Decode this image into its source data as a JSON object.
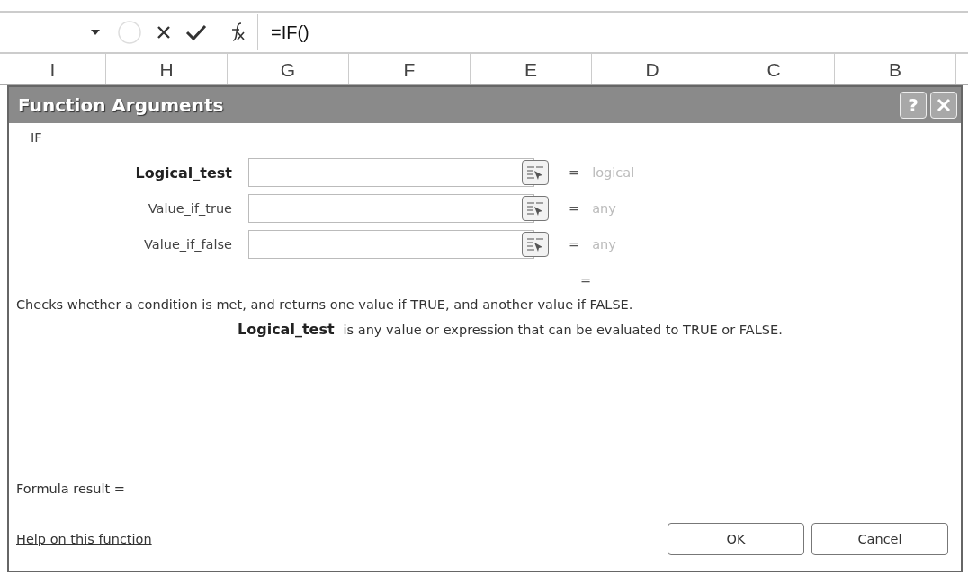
{
  "formula_bar": {
    "formula": "=IF()"
  },
  "column_headers": [
    "I",
    "H",
    "G",
    "F",
    "E",
    "D",
    "C",
    "B"
  ],
  "dialog": {
    "title": "Function Arguments",
    "help_button": "?",
    "function_name": "IF",
    "arguments": [
      {
        "name": "Logical_test",
        "selected": true,
        "equals": "=",
        "result": "logical"
      },
      {
        "name": "Value_if_true",
        "selected": false,
        "equals": "=",
        "result": "any"
      },
      {
        "name": "Value_if_false",
        "selected": false,
        "equals": "=",
        "result": "any"
      }
    ],
    "total_equals": "=",
    "description": "Checks whether a condition is met, and returns one value if TRUE, and another value if FALSE.",
    "argument_help": {
      "name": "Logical_test",
      "text": "is any value or expression that can be evaluated to TRUE or FALSE."
    },
    "formula_result": "Formula result =",
    "help_link": "Help on this function",
    "buttons": [
      "OK",
      "Cancel"
    ]
  }
}
